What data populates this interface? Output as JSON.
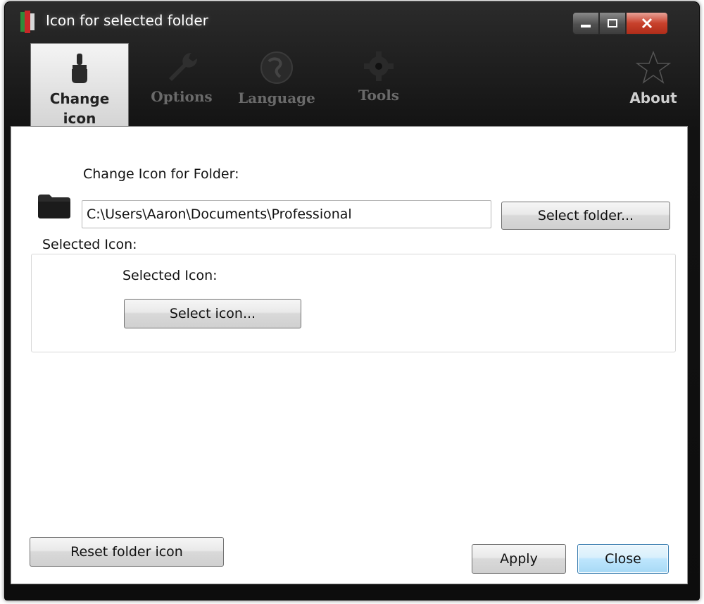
{
  "window": {
    "title": "Icon for selected folder",
    "controls": [
      "minimize",
      "maximize",
      "close"
    ]
  },
  "tabs": [
    {
      "id": "change-icon",
      "label_line1": "Change",
      "label_line2": "icon",
      "icon": "paintbrush-icon",
      "active": true
    },
    {
      "id": "options",
      "label": "Options",
      "icon": "wrench-icon",
      "active": false
    },
    {
      "id": "language",
      "label": "Language",
      "icon": "globe-icon",
      "active": false
    },
    {
      "id": "tools",
      "label": "Tools",
      "icon": "gear-icon",
      "active": false
    },
    {
      "id": "about",
      "label": "About",
      "icon": "star-icon",
      "active": false
    }
  ],
  "change_icon": {
    "folder_label": "Change Icon for Folder:",
    "folder_path": "C:\\Users\\Aaron\\Documents\\Professional",
    "select_folder_button": "Select folder...",
    "group_title": "Selected Icon:",
    "selected_icon_label": "Selected Icon:",
    "select_icon_button": "Select icon..."
  },
  "footer": {
    "reset_button": "Reset folder icon",
    "apply_button": "Apply",
    "close_button": "Close"
  },
  "colors": {
    "titlebar": "#121212",
    "close_button": "#c8412c",
    "focused_button": "#bee6fd"
  }
}
